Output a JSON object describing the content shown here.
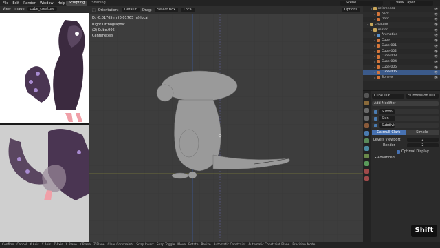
{
  "menu": [
    "File",
    "Edit",
    "Render",
    "Window",
    "Help"
  ],
  "workspaces": [
    {
      "label": "Sculpting",
      "active": true
    },
    {
      "label": "Shading",
      "active": false
    }
  ],
  "scene_label": "Scene",
  "view_layer_label": "View Layer",
  "image_editor": {
    "view": "View",
    "image": "Image",
    "image_name": "cube_creature"
  },
  "viewport": {
    "header": {
      "orientation_label": "Orientation:",
      "orientation_value": "Default",
      "drag_label": "Drag:",
      "drag_value": "Select Box",
      "transform_space": "Local",
      "options": "Options"
    },
    "move_readout": "D: -0.01765 m (0.01765 m) local",
    "view_name": "Right Orthographic",
    "object": "(2) Cube.006",
    "units": "Centimeters"
  },
  "outliner": {
    "rows": [
      {
        "label": "references",
        "indent": 2,
        "icon_color": "#c9a65a",
        "selected": false
      },
      {
        "label": "back",
        "indent": 3,
        "icon_color": "#d4763b",
        "selected": false
      },
      {
        "label": "front",
        "indent": 3,
        "icon_color": "#d4763b",
        "selected": false
      },
      {
        "label": "creature",
        "indent": 1,
        "icon_color": "#c9a65a",
        "selected": false
      },
      {
        "label": "mirror",
        "indent": 2,
        "icon_color": "#c9a65a",
        "selected": false
      },
      {
        "label": "Animation",
        "indent": 3,
        "icon_color": "#5a8fc9",
        "selected": false
      },
      {
        "label": "Cube",
        "indent": 3,
        "icon_color": "#d4763b",
        "selected": false
      },
      {
        "label": "Cube.001",
        "indent": 3,
        "icon_color": "#d4763b",
        "selected": false
      },
      {
        "label": "Cube.002",
        "indent": 3,
        "icon_color": "#d4763b",
        "selected": false
      },
      {
        "label": "Cube.003",
        "indent": 3,
        "icon_color": "#d4763b",
        "selected": false
      },
      {
        "label": "Cube.004",
        "indent": 3,
        "icon_color": "#d4763b",
        "selected": false
      },
      {
        "label": "Cube.005",
        "indent": 3,
        "icon_color": "#d4763b",
        "selected": false
      },
      {
        "label": "Cube.006",
        "indent": 3,
        "icon_color": "#d4763b",
        "selected": true
      },
      {
        "label": "Sphere",
        "indent": 3,
        "icon_color": "#d4763b",
        "selected": false
      }
    ]
  },
  "properties": {
    "object_name": "Cube.006",
    "modifier_name": "Subdivision.001",
    "add_modifier": "Add Modifier",
    "modifiers": [
      "Subdiv",
      "Skin",
      "Subdivisi"
    ],
    "subdiv_types": [
      {
        "label": "Catmull-Clark",
        "active": true
      },
      {
        "label": "Simple",
        "active": false
      }
    ],
    "levels_viewport_label": "Levels Viewport",
    "levels_viewport_value": "2",
    "render_label": "Render",
    "render_value": "2",
    "optimal_display": "Optimal Display",
    "advanced": "Advanced"
  },
  "statusbar": [
    "Confirm",
    "Cancel",
    "X Axis",
    "Y Axis",
    "Z Axis",
    "X Plane",
    "Y Plane",
    "Z Plane",
    "Clear Constraints",
    "Snap Invert",
    "Snap Toggle",
    "Move",
    "Rotate",
    "Resize",
    "Automatic Constraint",
    "Automatic Constraint Plane",
    "Precision Mode"
  ],
  "key_overlay": "Shift",
  "colors": {
    "accent": "#4772b3",
    "x_axis": "#8a3a3a",
    "y_axis": "#8a8a3a",
    "z_axis": "#3a5a9a"
  }
}
